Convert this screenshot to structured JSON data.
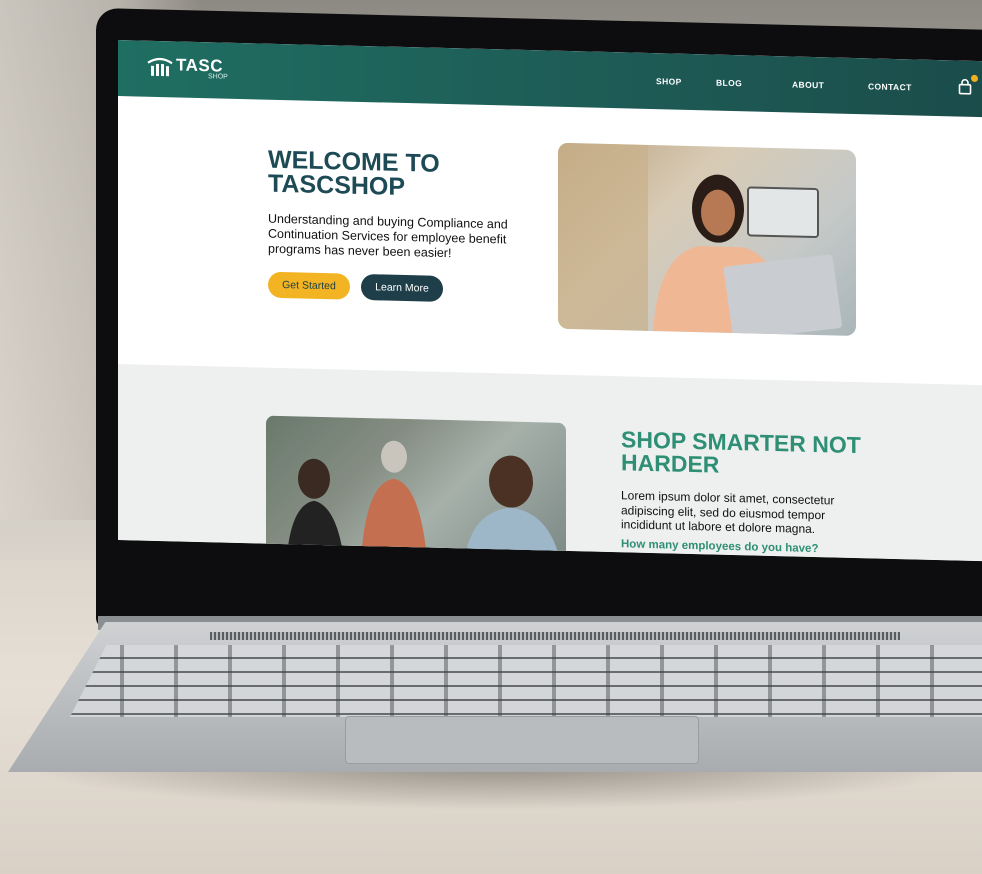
{
  "site": {
    "logo_text": "TASC",
    "logo_sub": "SHOP",
    "nav": [
      "SHOP",
      "BLOG",
      "ABOUT",
      "CONTACT"
    ]
  },
  "hero": {
    "title": "WELCOME TO TASCSHOP",
    "text": "Understanding and buying Compliance and Continuation Services for employee benefit programs has never been easier!",
    "primary_button": "Get Started",
    "secondary_button": "Learn More"
  },
  "section2": {
    "title": "SHOP SMARTER NOT HARDER",
    "text": "Lorem ipsum dolor sit amet, consectetur adipiscing elit, sed do eiusmod tempor incididunt ut labore et dolore magna.",
    "question": "How many employees do you have?"
  },
  "colors": {
    "header": "#1f6e62",
    "title_dark": "#1e4a55",
    "accent_green": "#2f8f74",
    "button_yellow": "#f2b422",
    "button_dark": "#1e3e4a"
  }
}
